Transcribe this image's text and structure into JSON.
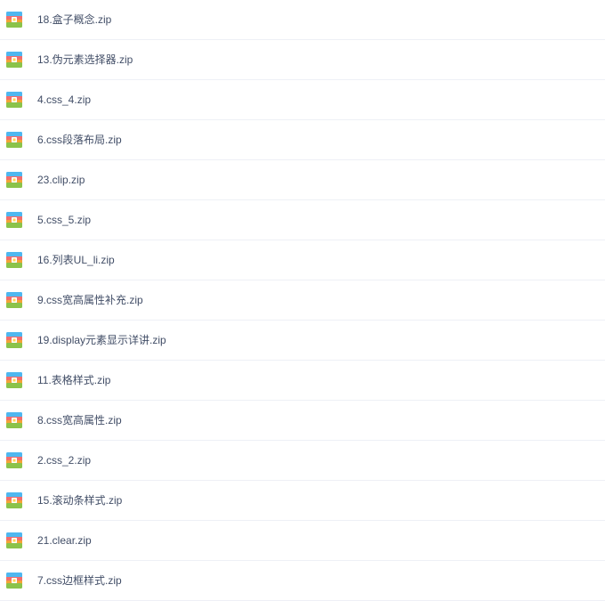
{
  "files": [
    {
      "name": "18.盒子概念.zip",
      "icon": "zip-archive-icon"
    },
    {
      "name": "13.伪元素选择器.zip",
      "icon": "zip-archive-icon"
    },
    {
      "name": "4.css_4.zip",
      "icon": "zip-archive-icon"
    },
    {
      "name": "6.css段落布局.zip",
      "icon": "zip-archive-icon"
    },
    {
      "name": "23.clip.zip",
      "icon": "zip-archive-icon"
    },
    {
      "name": "5.css_5.zip",
      "icon": "zip-archive-icon"
    },
    {
      "name": "16.列表UL_li.zip",
      "icon": "zip-archive-icon"
    },
    {
      "name": "9.css宽高属性补充.zip",
      "icon": "zip-archive-icon"
    },
    {
      "name": "19.display元素显示详讲.zip",
      "icon": "zip-archive-icon"
    },
    {
      "name": "11.表格样式.zip",
      "icon": "zip-archive-icon"
    },
    {
      "name": "8.css宽高属性.zip",
      "icon": "zip-archive-icon"
    },
    {
      "name": "2.css_2.zip",
      "icon": "zip-archive-icon"
    },
    {
      "name": "15.滚动条样式.zip",
      "icon": "zip-archive-icon"
    },
    {
      "name": "21.clear.zip",
      "icon": "zip-archive-icon"
    },
    {
      "name": "7.css边框样式.zip",
      "icon": "zip-archive-icon"
    }
  ],
  "colors": {
    "text": "#424e67",
    "divider": "#eef0f6",
    "icon_red": "#f26d6d",
    "icon_blue": "#4fb7f0",
    "icon_orange": "#f4a236",
    "icon_green": "#8bc34a",
    "icon_yellow": "#ffd54f"
  }
}
